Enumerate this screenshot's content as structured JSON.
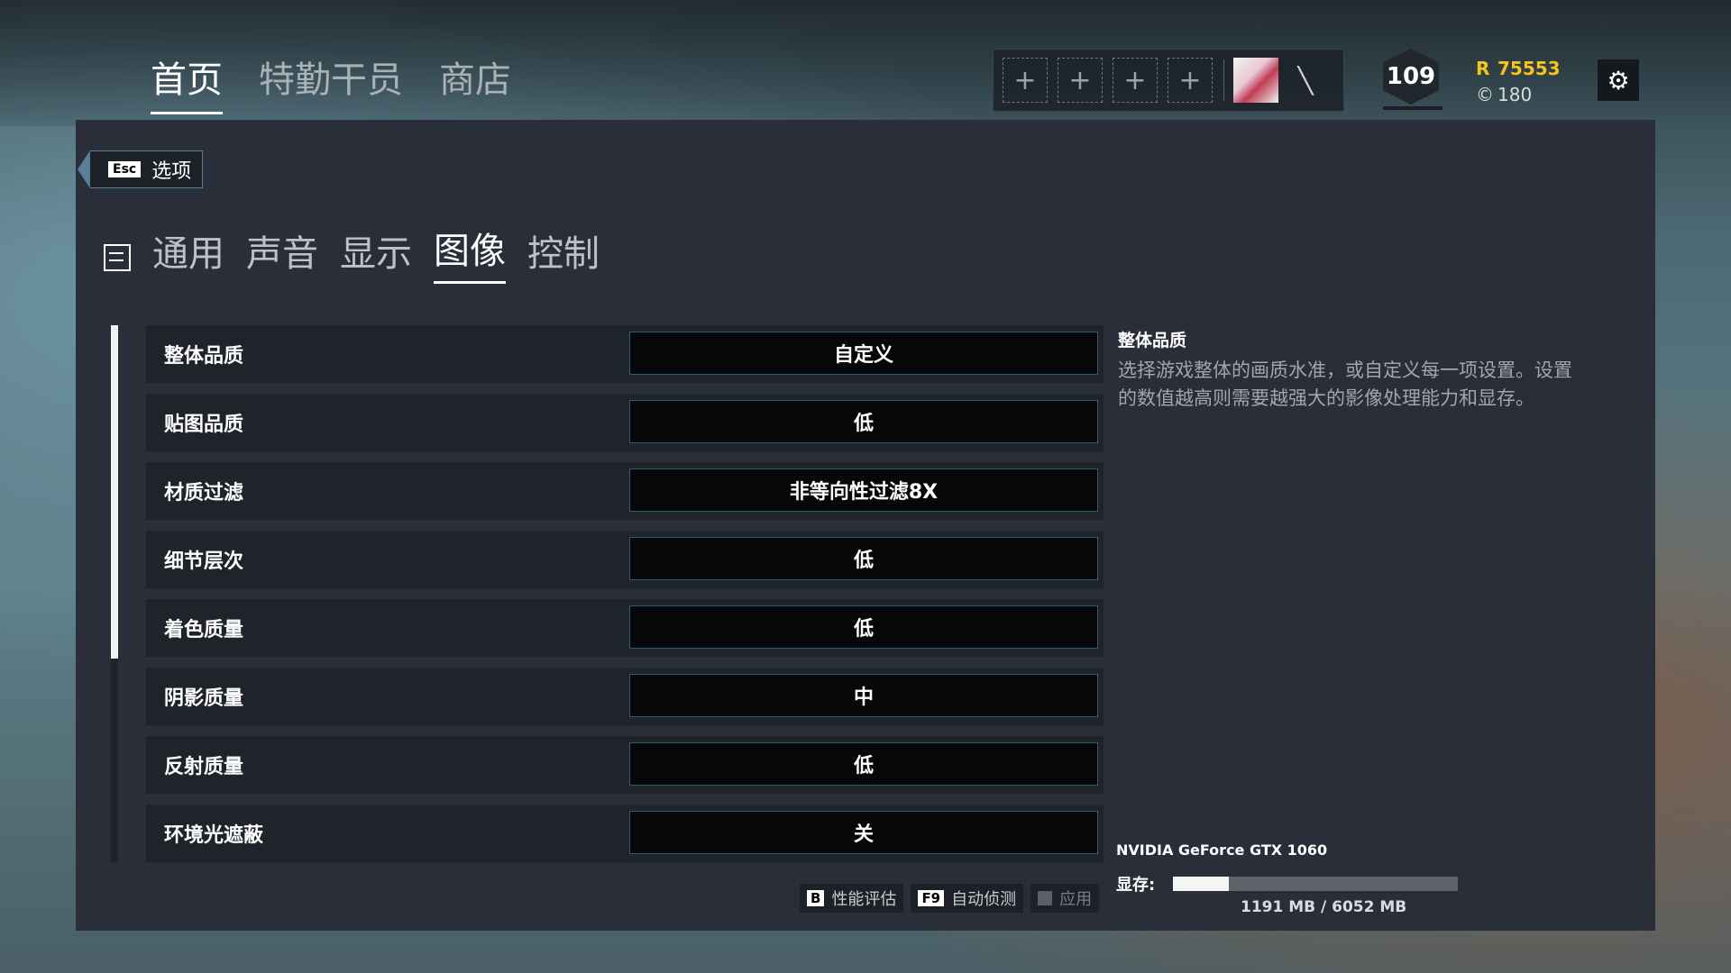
{
  "top_nav": {
    "tabs": [
      "首页",
      "特勤干员",
      "商店"
    ],
    "active": 0
  },
  "squad": {
    "slot_symbol": "+",
    "knife_symbol": "╲"
  },
  "player": {
    "level": "109",
    "credits": "75553",
    "renown": "180"
  },
  "header_icons": {
    "gear": "⚙",
    "credits_icon": "R",
    "renown_icon": "©"
  },
  "esc_button": {
    "key": "Esc",
    "label": "选项"
  },
  "sub_tabs": {
    "tabs": [
      "通用",
      "声音",
      "显示",
      "图像",
      "控制"
    ],
    "active": 3
  },
  "settings": [
    {
      "label": "整体品质",
      "value": "自定义"
    },
    {
      "label": "贴图品质",
      "value": "低"
    },
    {
      "label": "材质过滤",
      "value": "非等向性过滤8X"
    },
    {
      "label": "细节层次",
      "value": "低"
    },
    {
      "label": "着色质量",
      "value": "低"
    },
    {
      "label": "阴影质量",
      "value": "中"
    },
    {
      "label": "反射质量",
      "value": "低"
    },
    {
      "label": "环境光遮蔽",
      "value": "关"
    }
  ],
  "scroll": {
    "visible_fraction": 0.62
  },
  "buttons": [
    {
      "key": "B",
      "label": "性能评估"
    },
    {
      "key": "F9",
      "label": "自动侦测"
    },
    {
      "key": "",
      "label": "应用"
    }
  ],
  "description": {
    "title": "整体品质",
    "text": "选择游戏整体的画质水准，或自定义每一项设置。设置的数值越高则需要越强大的影像处理能力和显存。"
  },
  "gpu": {
    "name": "NVIDIA GeForce GTX 1060",
    "vram_label": "显存:",
    "vram_text": "1191 MB / 6052 MB",
    "vram_used_fraction": 0.197
  }
}
